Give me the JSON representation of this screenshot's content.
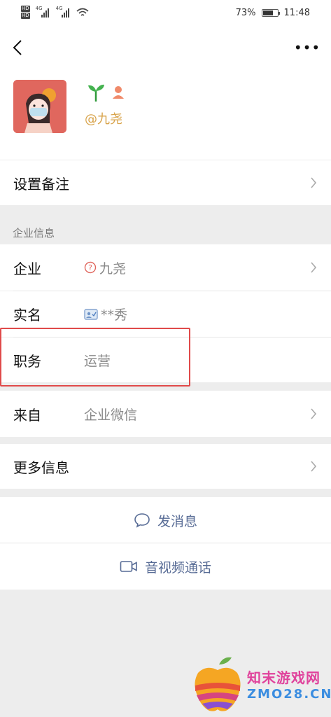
{
  "status_bar": {
    "battery": "73%",
    "time": "11:48",
    "battery_level": 0.73
  },
  "nav": {
    "back_icon": "chevron-left-icon",
    "more_icon": "more-dots-icon",
    "more_glyph": "•••"
  },
  "profile": {
    "handle": "@九尧",
    "icons": [
      "sprout-icon",
      "person-icon"
    ]
  },
  "rows": {
    "remark": {
      "label": "设置备注"
    },
    "section_header": "企业信息",
    "company": {
      "label": "企业",
      "value": "九尧"
    },
    "realname": {
      "label": "实名",
      "value": "**秀"
    },
    "position": {
      "label": "职务",
      "value": "运营"
    },
    "source": {
      "label": "来自",
      "value": "企业微信"
    },
    "more_info": {
      "label": "更多信息"
    }
  },
  "actions": {
    "message": "发消息",
    "video_call": "音视频通话"
  },
  "watermark": {
    "cn": "知末游戏网",
    "en": "ZMO28.CN"
  },
  "colors": {
    "link": "#576b95",
    "highlight": "#e04a4a",
    "handle": "#d8a34a"
  }
}
